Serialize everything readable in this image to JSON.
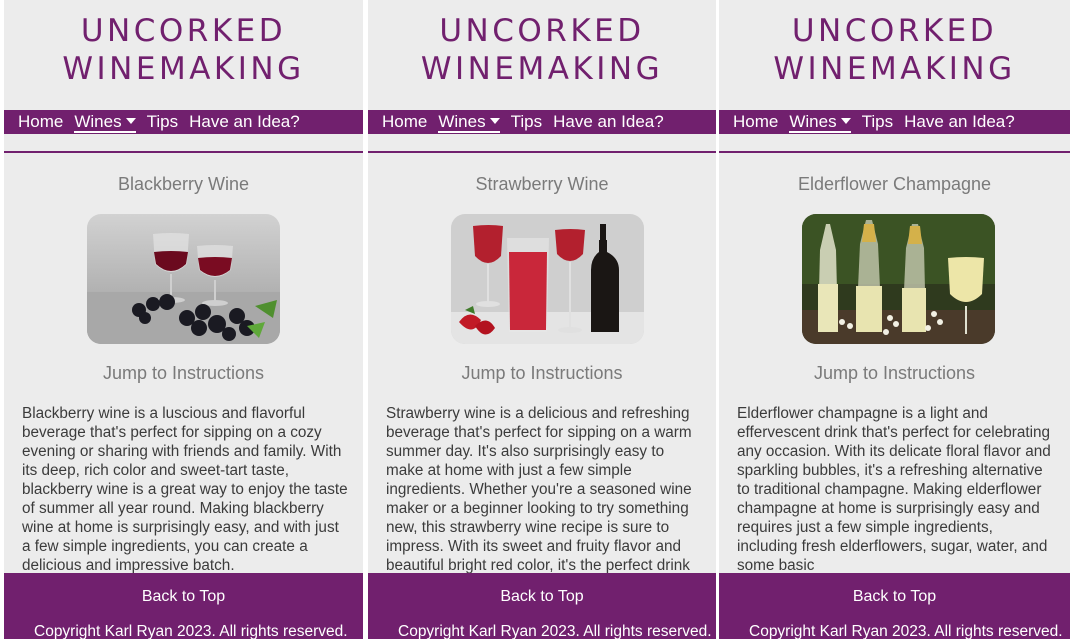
{
  "brand": {
    "line1": "UNCORKED",
    "line2": "WINEMAKING"
  },
  "nav": {
    "home": "Home",
    "wines": "Wines",
    "tips": "Tips",
    "idea": "Have an Idea?"
  },
  "panels": [
    {
      "title": "Blackberry Wine",
      "image_alt": "blackberry-wine-photo",
      "jump": "Jump to Instructions",
      "description": "Blackberry wine is a luscious and flavorful beverage that's perfect for sipping on a cozy evening or sharing with friends and family. With its deep, rich color and sweet-tart taste, blackberry wine is a great way to enjoy the taste of summer all year round. Making blackberry wine at home is surprisingly easy, and with just a few simple ingredients, you can create a delicious and impressive batch."
    },
    {
      "title": "Strawberry Wine",
      "image_alt": "strawberry-wine-photo",
      "jump": "Jump to Instructions",
      "description": "Strawberry wine is a delicious and refreshing beverage that's perfect for sipping on a warm summer day. It's also surprisingly easy to make at home with just a few simple ingredients. Whether you're a seasoned wine maker or a beginner looking to try something new, this strawberry wine recipe is sure to impress. With its sweet and fruity flavor and beautiful bright red color, it's the perfect drink"
    },
    {
      "title": "Elderflower Champagne",
      "image_alt": "elderflower-champagne-photo",
      "jump": "Jump to Instructions",
      "description": "Elderflower champagne is a light and effervescent drink that's perfect for celebrating any occasion. With its delicate floral flavor and sparkling bubbles, it's a refreshing alternative to traditional champagne. Making elderflower champagne at home is surprisingly easy and requires just a few simple ingredients, including fresh elderflowers, sugar, water, and some basic"
    }
  ],
  "footer": {
    "back_to_top": "Back to Top",
    "copyright": "Copyright Karl Ryan 2023. All rights reserved."
  },
  "colors": {
    "brand": "#71206e",
    "panel_bg": "#ececec",
    "heading_gray": "#7a7a7a"
  }
}
